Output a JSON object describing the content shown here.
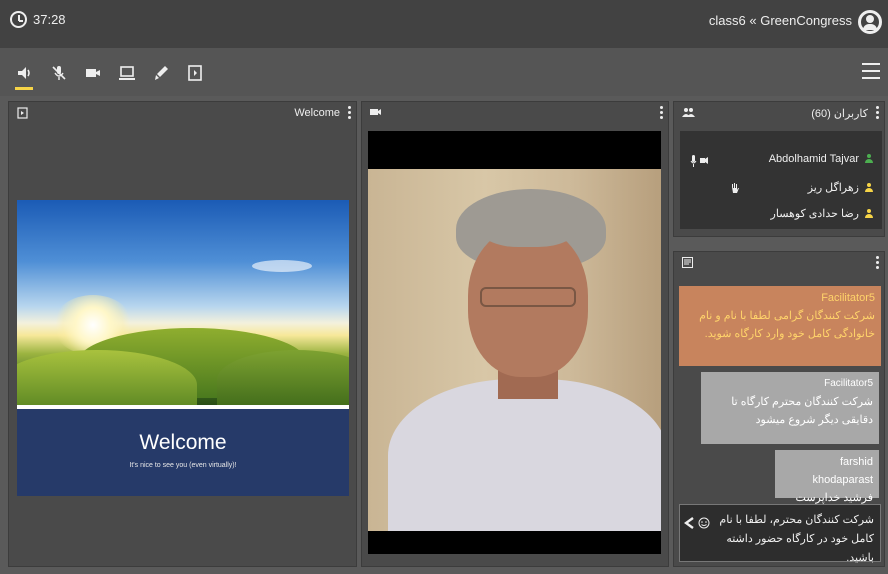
{
  "topbar": {
    "timer": "37:28",
    "title": "class6 « GreenCongress"
  },
  "toolbar": {
    "tools": [
      "volume-icon",
      "mic-off-icon",
      "camera-icon",
      "screen-share-icon",
      "whiteboard-pen-icon",
      "presentation-icon"
    ],
    "accent_color": "#f6d447"
  },
  "presentation": {
    "header": "Welcome",
    "slide_title": "Welcome",
    "slide_subtitle": "It's nice to see you (even virtually)!"
  },
  "users": {
    "header": "کاربران (60)",
    "items": [
      {
        "name": "Abdolhamid Tajvar",
        "color": "#4caf50",
        "has_mic": true,
        "has_cam": true
      },
      {
        "name": "زهراگل ریز",
        "color": "#f6d447",
        "hand_raised": true
      },
      {
        "name": "رضا حدادی کوهسار",
        "color": "#f6d447"
      }
    ]
  },
  "chat": {
    "messages": [
      {
        "sender": "Facilitator5",
        "text": "شرکت کنندگان گرامی لطفا با نام و نام خانوادگی کامل خود وارد کارگاه شوید."
      },
      {
        "sender": "Facilitator5",
        "text": "شرکت کنندگان محترم کارگاه تا دقایقی دیگر شروع میشود"
      },
      {
        "sender": "farshid khodaparast",
        "text": "فرشید خداپرست گازرونی"
      }
    ],
    "input_text": "شرکت کنندگان محترم، لطفا با نام کامل خود در کارگاه حضور داشته باشید."
  }
}
